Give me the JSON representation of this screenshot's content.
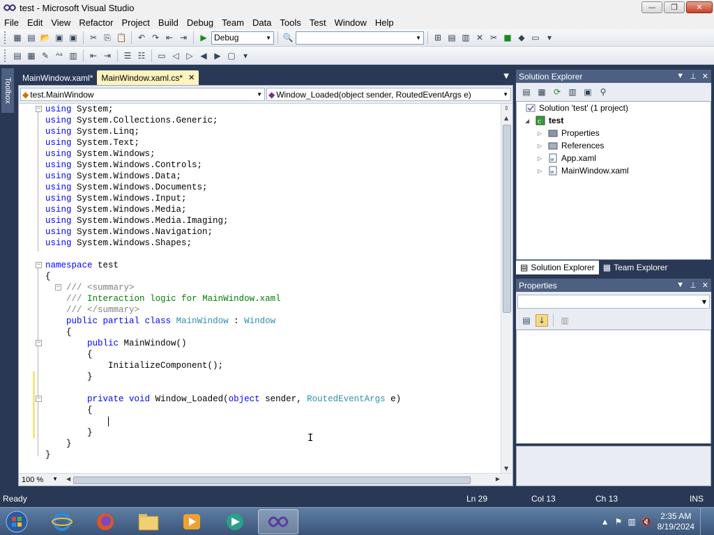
{
  "window": {
    "title": "test - Microsoft Visual Studio"
  },
  "menu": [
    "File",
    "Edit",
    "View",
    "Refactor",
    "Project",
    "Build",
    "Debug",
    "Team",
    "Data",
    "Tools",
    "Test",
    "Window",
    "Help"
  ],
  "toolbar": {
    "config_value": "Debug",
    "platform_value": ""
  },
  "toolbox": {
    "label": "Toolbox"
  },
  "doc_tabs": [
    {
      "label": "MainWindow.xaml*",
      "active": false
    },
    {
      "label": "MainWindow.xaml.cs*",
      "active": true
    }
  ],
  "nav": {
    "class_combo": "test.MainWindow",
    "member_combo": "Window_Loaded(object sender, RoutedEventArgs e)"
  },
  "editor": {
    "zoom": "100 %"
  },
  "solution_explorer": {
    "title": "Solution Explorer",
    "solution_label": "Solution 'test' (1 project)",
    "project": "test",
    "items": [
      "Properties",
      "References",
      "App.xaml",
      "MainWindow.xaml"
    ],
    "tabs": [
      "Solution Explorer",
      "Team Explorer"
    ]
  },
  "properties": {
    "title": "Properties"
  },
  "status": {
    "ready": "Ready",
    "ln": "Ln 29",
    "col": "Col 13",
    "ch": "Ch 13",
    "mode": "INS"
  },
  "taskbar": {
    "time": "2:35 AM",
    "date": "8/19/2024"
  },
  "colors": {
    "keyword": "#0000ff",
    "type": "#2b91af",
    "comment": "#008000",
    "chrome": "#293955"
  }
}
